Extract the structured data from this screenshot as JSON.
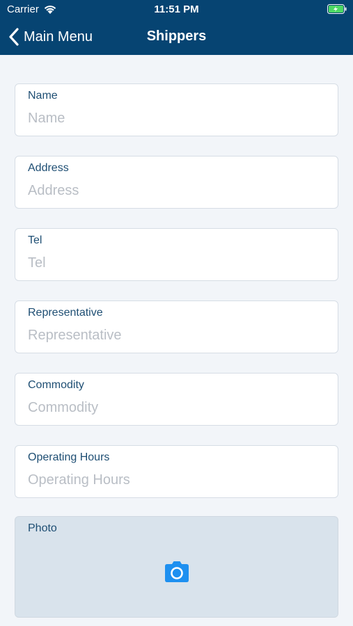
{
  "status_bar": {
    "carrier": "Carrier",
    "time": "11:51 PM",
    "icons": [
      "wifi-icon",
      "battery-charging-icon"
    ]
  },
  "nav": {
    "back_label": "Main Menu",
    "title": "Shippers"
  },
  "form": {
    "fields": [
      {
        "label": "Name",
        "placeholder": "Name"
      },
      {
        "label": "Address",
        "placeholder": "Address"
      },
      {
        "label": "Tel",
        "placeholder": "Tel"
      },
      {
        "label": "Representative",
        "placeholder": "Representative"
      },
      {
        "label": "Commodity",
        "placeholder": "Commodity"
      },
      {
        "label": "Operating Hours",
        "placeholder": "Operating Hours"
      }
    ],
    "photo": {
      "label": "Photo",
      "icon": "camera-icon"
    }
  },
  "colors": {
    "header_bg": "#064472",
    "page_bg": "#f2f5f9",
    "label": "#1e4e73",
    "placeholder": "#b9bec5",
    "photo_bg": "#d9e3ec",
    "camera": "#1e90f0",
    "battery_charge": "#4cd964"
  }
}
